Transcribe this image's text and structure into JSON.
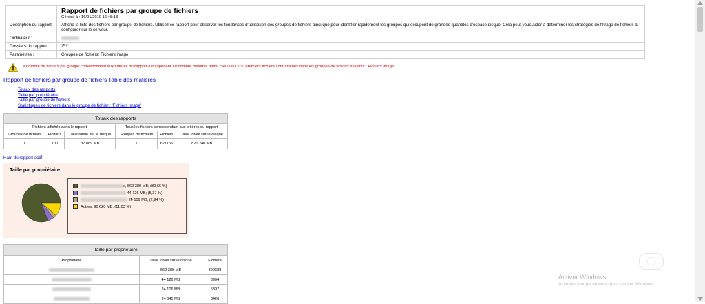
{
  "report": {
    "title": "Rapport de fichiers par groupe de fichiers",
    "generated": "Généré à : 16/01/2019 16:48:13",
    "rows": [
      {
        "label": "Description du rapport :",
        "value": "Affiche la liste des fichiers par groupe de fichiers. Utilisez ce rapport pour observer les tendances d'utilisation des groupes de fichiers ainsi que pour identifier rapidement les groupes qui occupent de grandes quantités d'espace disque. Cela peut vous aider à déterminer les stratégies de filtrage de fichiers à configurer sur le serveur."
      },
      {
        "label": "Ordinateur :",
        "value": ""
      },
      {
        "label": "Dossiers du rapport :",
        "value": "'E:\\'"
      },
      {
        "label": "Paramètres :",
        "value": "Groupes de fichiers: Fichiers image"
      }
    ]
  },
  "warning": {
    "icon": "warning-icon",
    "text": "Le nombre de fichiers par groupe correspondant aux critères du rapport est supérieur au nombre maximal défini. Seuls les 100 premiers fichiers sont affichés dans les groupes de fichiers suivants : Fichiers image."
  },
  "toc": {
    "title": "Rapport de fichiers par groupe de fichiers Table des matières",
    "links": [
      "Totaux des rapports",
      "Taille par propriétaire",
      "Taille par groupe de fichiers",
      "Statistiques de fichiers dans le groupe de fichier : 'Fichiers image'"
    ]
  },
  "totals": {
    "caption": "Totaux des rapports",
    "group_left": "Fichiers affichés dans le rapport",
    "group_right": "Tous les fichiers correspondant aux critères du rapport",
    "headers": [
      "Groupes de fichiers",
      "Fichiers",
      "Taille totale sur le disque",
      "Groupes de fichiers",
      "Fichiers",
      "Taille totale sur le disque"
    ],
    "values": [
      "1",
      "100",
      "37 889 MB",
      "1",
      "627156",
      "821 240 MB"
    ]
  },
  "top_link": "Haut du rapport actif",
  "owner_chart": {
    "title": "Taille par propriétaire",
    "legend": [
      {
        "suffix": "s, 662 389 MB; (80,66 %)",
        "color": "#4e5a2e"
      },
      {
        "suffix": "44 126 MB; (5,37 %)",
        "color": "#8a70c8"
      },
      {
        "suffix": "24 106 MB; (2,94 %)",
        "color": "#b8a888"
      },
      {
        "suffix": "Autres; 90 620 MB; (11,03 %)",
        "color": "#ffd700"
      }
    ]
  },
  "chart_data": {
    "type": "pie",
    "title": "Taille par propriétaire",
    "labels": [
      "",
      "",
      "",
      "Autres"
    ],
    "values": [
      662389,
      44126,
      24106,
      90620
    ],
    "percentages": [
      80.66,
      5.37,
      2.94,
      11.03
    ],
    "colors": [
      "#4e5a2e",
      "#8a70c8",
      "#b8a888",
      "#ffd700"
    ],
    "unit": "MB"
  },
  "owner_table": {
    "caption": "Taille par propriétaire",
    "headers": [
      "Propriétaire",
      "Taille totale sur le disque",
      "Fichiers"
    ],
    "rows": [
      {
        "owner": "",
        "size": "662 389 MB",
        "files": "390688"
      },
      {
        "owner": "",
        "size": "44 126 MB",
        "files": "8994"
      },
      {
        "owner": "",
        "size": "24 106 MB",
        "files": "5397"
      },
      {
        "owner": "",
        "size": "24 045 MB",
        "files": "3426"
      }
    ]
  },
  "watermark": {
    "line1": "Activer Windows",
    "line2": "Accédez aux paramètres pour activer Windows."
  }
}
